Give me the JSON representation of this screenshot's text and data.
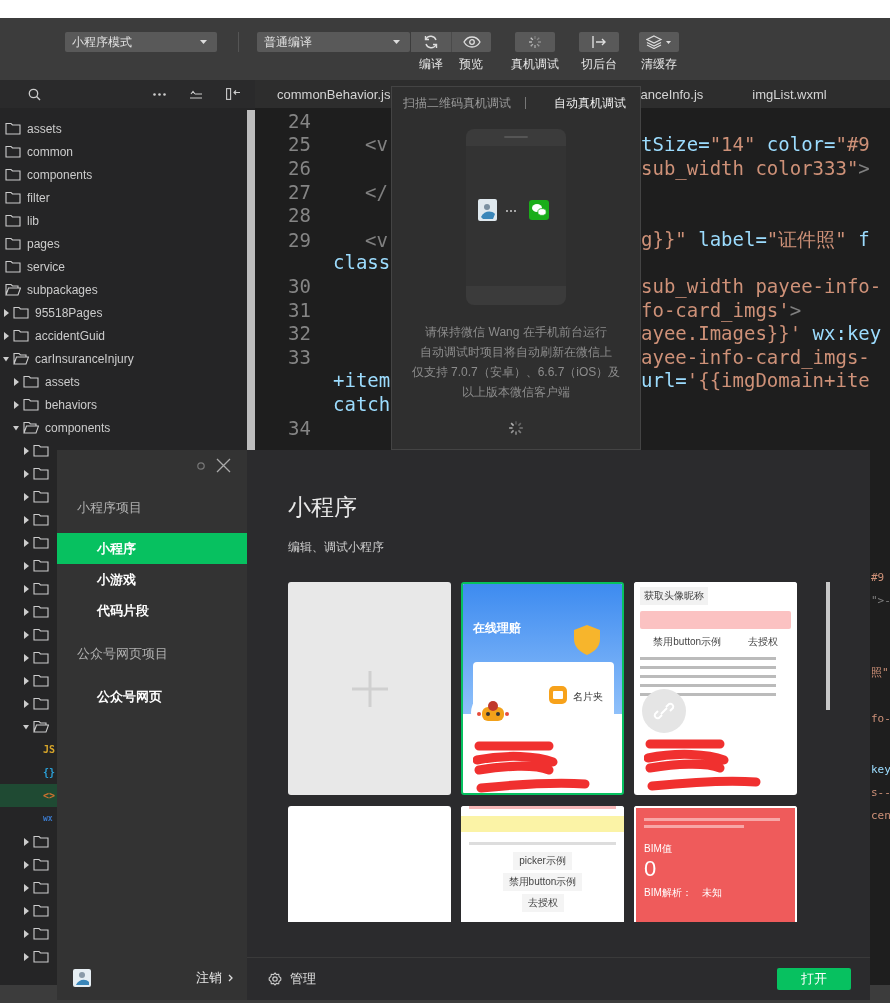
{
  "toolbar": {
    "mode_dropdown": "小程序模式",
    "compile_dropdown": "普通编译",
    "tools": [
      {
        "kind": "refresh",
        "label": "编译"
      },
      {
        "kind": "preview",
        "label": "预览"
      },
      {
        "kind": "device_debug",
        "label": "真机调试"
      },
      {
        "kind": "background",
        "label": "切后台"
      },
      {
        "kind": "cache",
        "label": "清缓存"
      }
    ]
  },
  "explorer": {
    "tree": [
      {
        "name": "assets",
        "expanded": false
      },
      {
        "name": "common",
        "expanded": false
      },
      {
        "name": "components",
        "expanded": false
      },
      {
        "name": "filter",
        "expanded": false
      },
      {
        "name": "lib",
        "expanded": false
      },
      {
        "name": "pages",
        "expanded": false
      },
      {
        "name": "service",
        "expanded": false
      },
      {
        "name": "subpackages",
        "expanded": true,
        "children": [
          {
            "name": "95518Pages",
            "expanded": false
          },
          {
            "name": "accidentGuid",
            "expanded": false
          },
          {
            "name": "carInsuranceInjury",
            "expanded": true,
            "children": [
              {
                "name": "assets",
                "expanded": false
              },
              {
                "name": "behaviors",
                "expanded": false
              },
              {
                "name": "components",
                "expanded": true,
                "children": [
                  {
                    "expanded": false
                  },
                  {
                    "expanded": false
                  },
                  {
                    "expanded": false
                  },
                  {
                    "expanded": false
                  },
                  {
                    "expanded": false
                  },
                  {
                    "expanded": false
                  },
                  {
                    "expanded": false
                  },
                  {
                    "expanded": false
                  },
                  {
                    "expanded": false
                  },
                  {
                    "expanded": false
                  },
                  {
                    "expanded": false
                  },
                  {
                    "expanded": false
                  },
                  {
                    "expanded": true,
                    "children": [
                      {
                        "kind": "js",
                        "icon": "JS",
                        "selected": false
                      },
                      {
                        "kind": "json",
                        "icon": "{}",
                        "selected": false
                      },
                      {
                        "kind": "wxml",
                        "icon": "<>",
                        "selected": true
                      },
                      {
                        "kind": "wxss",
                        "icon": "wx",
                        "selected": false
                      }
                    ]
                  },
                  {
                    "expanded": false
                  },
                  {
                    "expanded": false
                  },
                  {
                    "expanded": false
                  },
                  {
                    "expanded": false
                  },
                  {
                    "expanded": false
                  },
                  {
                    "expanded": false
                  }
                ]
              }
            ]
          }
        ]
      }
    ]
  },
  "editor": {
    "tabs": [
      {
        "label": "commonBehavior.js"
      },
      {
        "label": "anceInfo.js"
      },
      {
        "label": "imgList.wxml"
      }
    ],
    "lines": [
      {
        "number": "24"
      },
      {
        "number": "25",
        "left": [
          {
            "text": "<v",
            "kind": "tag"
          }
        ],
        "right": [
          {
            "text": "tSize=",
            "kind": "attr"
          },
          {
            "text": "\"14\"",
            "kind": "string"
          },
          {
            "text": " color=",
            "kind": "attr"
          },
          {
            "text": "\"#9",
            "kind": "string"
          }
        ]
      },
      {
        "number": "26",
        "right": [
          {
            "text": "sub_width color333\"",
            "kind": "string"
          },
          {
            "text": ">",
            "kind": "tag"
          }
        ]
      },
      {
        "number": "27",
        "left": [
          {
            "text": "</",
            "kind": "tag"
          }
        ]
      },
      {
        "number": "28"
      },
      {
        "number": "29",
        "left": [
          {
            "text": "<v",
            "kind": "tag"
          }
        ],
        "right": [
          {
            "text": "g}}\"",
            "kind": "string"
          },
          {
            "text": " label=",
            "kind": "attr"
          },
          {
            "text": "\"证件照\"",
            "kind": "string"
          },
          {
            "text": " f",
            "kind": "attr"
          }
        ]
      },
      {
        "left": [
          {
            "text": "class",
            "kind": "attr"
          }
        ]
      },
      {
        "number": "30",
        "right": [
          {
            "text": "sub_width payee-info-",
            "kind": "string"
          }
        ]
      },
      {
        "number": "31",
        "right": [
          {
            "text": "fo-card_imgs'",
            "kind": "string"
          },
          {
            "text": ">",
            "kind": "tag"
          }
        ]
      },
      {
        "number": "32",
        "right": [
          {
            "text": "ayee.Images}}'",
            "kind": "string"
          },
          {
            "text": " wx:key",
            "kind": "attr"
          }
        ]
      },
      {
        "number": "33",
        "right": [
          {
            "text": "ayee-info-card_imgs-",
            "kind": "string"
          }
        ]
      },
      {
        "left": [
          {
            "text": "+item",
            "kind": "attr"
          }
        ],
        "right": [
          {
            "text": "url=",
            "kind": "attr"
          },
          {
            "text": "'{{imgDomain+ite",
            "kind": "string"
          }
        ]
      },
      {
        "left": [
          {
            "text": "catch",
            "kind": "attr"
          }
        ]
      },
      {
        "number": "34"
      }
    ],
    "edge_fragments": [
      {
        "text": "#9",
        "kind": "string"
      },
      {
        "text": "\">-",
        "kind": "tag"
      },
      {
        "text": "照\"",
        "kind": "string"
      },
      {
        "text": "fo-",
        "kind": "string"
      },
      {
        "text": "key",
        "kind": "attr"
      },
      {
        "text": "s--",
        "kind": "string"
      },
      {
        "text": "cen",
        "kind": "string"
      }
    ]
  },
  "device_debug_popup": {
    "tabs": [
      {
        "label": "扫描二维码真机调试",
        "selected": false
      },
      {
        "label": "自动真机调试",
        "selected": true
      }
    ],
    "message_lines": [
      "请保持微信 Wang 在手机前台运行",
      "自动调试时项目将自动刷新在微信上",
      "仅支持 7.0.7（安卓）、6.6.7（iOS）及",
      "以上版本微信客户端"
    ]
  },
  "project_dialog": {
    "sidebar": {
      "sections": [
        {
          "heading": "小程序项目",
          "items": [
            {
              "label": "小程序",
              "selected": true
            },
            {
              "label": "小游戏",
              "selected": false
            },
            {
              "label": "代码片段",
              "selected": false
            }
          ]
        },
        {
          "heading": "公众号网页项目",
          "items": [
            {
              "label": "公众号网页",
              "selected": false
            }
          ]
        }
      ],
      "logout": "注销"
    },
    "title": "小程序",
    "subtitle": "编辑、调试小程序",
    "cards": [
      {
        "kind": "new",
        "selected": false
      },
      {
        "kind": "project",
        "selected": true,
        "preview": {
          "kind": "banner",
          "texts": [
            "在线理赔",
            "名片夹"
          ]
        },
        "avatar": {
          "kind": "mascot"
        },
        "redacted": true
      },
      {
        "kind": "project",
        "selected": false,
        "preview": {
          "kind": "list",
          "texts": [
            "获取头像昵称",
            "禁用button示例",
            "去授权"
          ]
        },
        "avatar": {
          "kind": "link"
        },
        "redacted": true
      },
      {
        "kind": "project",
        "selected": false
      },
      {
        "kind": "project",
        "selected": false,
        "preview": {
          "kind": "form",
          "texts": [
            "picker示例",
            "禁用button示例",
            "去授权"
          ]
        }
      },
      {
        "kind": "project",
        "selected": false,
        "preview": {
          "kind": "bmi",
          "texts": [
            "BIM值",
            "0",
            "BIM解析：",
            "未知"
          ]
        }
      }
    ],
    "manage": "管理",
    "open_button": "打开"
  }
}
